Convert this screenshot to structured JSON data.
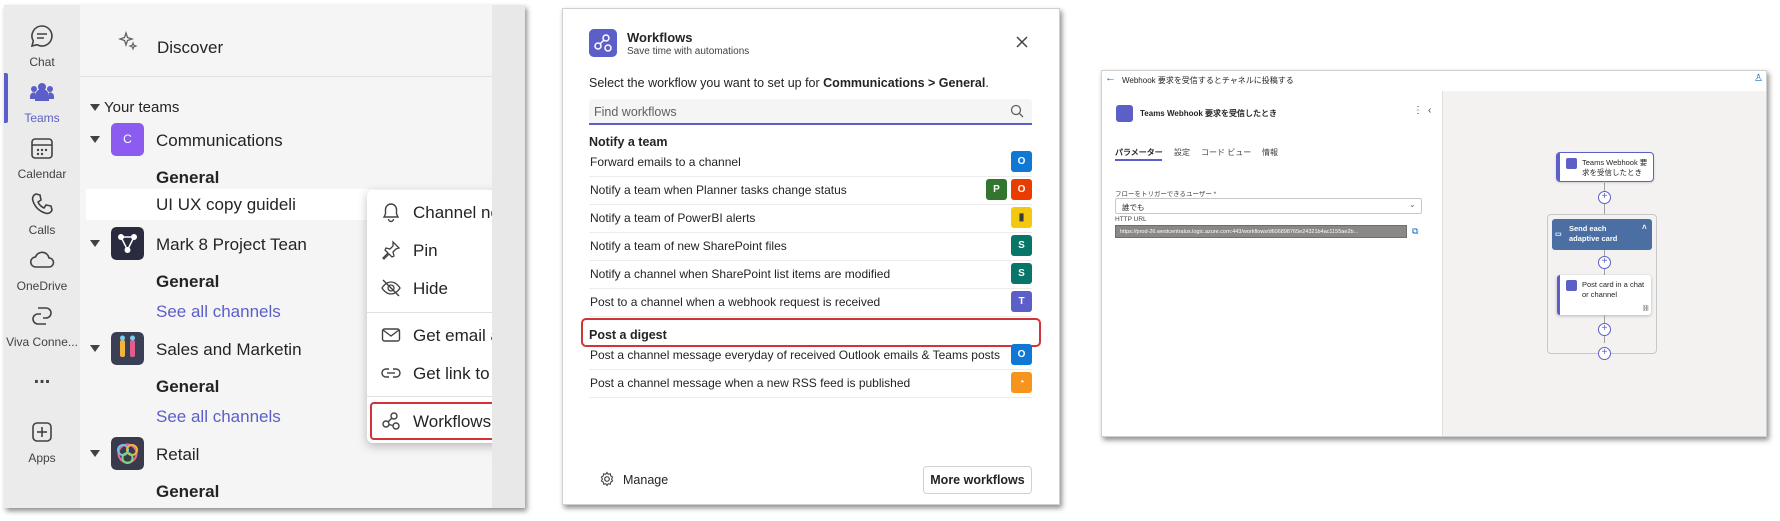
{
  "teams": {
    "rail": [
      {
        "label": "Chat",
        "icon": "chat-icon"
      },
      {
        "label": "Teams",
        "icon": "teams-icon"
      },
      {
        "label": "Calendar",
        "icon": "calendar-icon"
      },
      {
        "label": "Calls",
        "icon": "calls-icon"
      },
      {
        "label": "OneDrive",
        "icon": "onedrive-icon"
      },
      {
        "label": "Viva Conne...",
        "icon": "viva-icon"
      },
      {
        "label": "...",
        "icon": "more-icon"
      },
      {
        "label": "Apps",
        "icon": "apps-icon"
      }
    ],
    "discover_label": "Discover",
    "your_teams_label": "Your teams",
    "teams": [
      {
        "name": "Communications",
        "avatar_letter": "C",
        "channels": [
          "General",
          "UI UX copy guideli"
        ]
      },
      {
        "name": "Mark 8 Project Tean",
        "channels": [
          "General"
        ],
        "see_all": "See all channels"
      },
      {
        "name": "Sales and Marketin",
        "channels": [
          "General"
        ],
        "see_all": "See all channels"
      },
      {
        "name": "Retail",
        "channels": [
          "General"
        ]
      }
    ],
    "context_menu": [
      {
        "label": "Channel notifications",
        "icon": "bell-icon"
      },
      {
        "label": "Pin",
        "icon": "pin-icon"
      },
      {
        "label": "Hide",
        "icon": "eye-off-icon"
      },
      {
        "label": "Get email address",
        "icon": "mail-icon"
      },
      {
        "label": "Get link to channel",
        "icon": "link-icon"
      },
      {
        "label": "Workflows",
        "icon": "workflows-icon"
      }
    ],
    "colors": {
      "accent": "#5b5fc7",
      "highlight": "#d13438"
    }
  },
  "workflows": {
    "title": "Workflows",
    "subtitle": "Save time with automations",
    "prompt_prefix": "Select the workflow you want to set up for ",
    "prompt_target": "Communications > General",
    "prompt_suffix": ".",
    "search_placeholder": "Find workflows",
    "sections": [
      {
        "title": "Notify a team",
        "items": [
          {
            "label": "Forward emails to a channel",
            "icons": [
              "outlook-icon"
            ]
          },
          {
            "label": "Notify a team when Planner tasks change status",
            "icons": [
              "planner-icon",
              "office-icon"
            ]
          },
          {
            "label": "Notify a team of PowerBI alerts",
            "icons": [
              "powerbi-icon"
            ]
          },
          {
            "label": "Notify a team of new SharePoint files",
            "icons": [
              "sharepoint-icon"
            ]
          },
          {
            "label": "Notify a channel when SharePoint list items are modified",
            "icons": [
              "sharepoint-icon"
            ]
          },
          {
            "label": "Post to a channel when a webhook request is received",
            "icons": [
              "teams-icon"
            ]
          }
        ]
      },
      {
        "title": "Post a digest",
        "items": [
          {
            "label": "Post a channel message everyday of received Outlook emails & Teams posts",
            "icons": [
              "outlook-icon"
            ]
          },
          {
            "label": "Post a channel message when a new RSS feed is published",
            "icons": [
              "rss-icon"
            ]
          }
        ]
      }
    ],
    "manage_label": "Manage",
    "more_label": "More workflows"
  },
  "designer": {
    "breadcrumb": "Webhook 要求を受信するとチャネルに投稿する",
    "trigger_title": "Teams Webhook 要求を受信したとき",
    "tabs": [
      "パラメーター",
      "設定",
      "コード ビュー",
      "情報"
    ],
    "field_label": "フローをトリガーできるユーザー *",
    "field_value": "誰でも",
    "url_label": "HTTP URL",
    "url_value": "https://prod-26.westcentralus.logic.azure.com:443/workflows/d606898765e24321b4ac1155ae2b...",
    "nodes": {
      "trigger": "Teams Webhook 要求を受信したとき",
      "foreach": "Send each adaptive card",
      "action": "Post card in a chat or channel"
    }
  }
}
